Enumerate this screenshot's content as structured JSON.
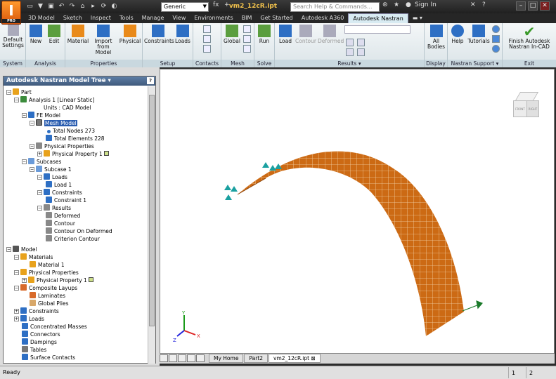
{
  "title": {
    "app_logo_letter": "I",
    "app_logo_badge": "PRO",
    "document": "vm2_12cR.ipt",
    "material_dropdown": "Generic",
    "search_placeholder": "Search Help & Commands...",
    "sign_in": "Sign In"
  },
  "tabs": [
    "3D Model",
    "Sketch",
    "Inspect",
    "Tools",
    "Manage",
    "View",
    "Environments",
    "BIM",
    "Get Started",
    "Autodesk A360",
    "Autodesk Nastran"
  ],
  "active_tab": "Autodesk Nastran",
  "ribbon": {
    "system": {
      "label": "System",
      "buttons": [
        "Default Settings"
      ]
    },
    "analysis": {
      "label": "Analysis",
      "buttons": [
        "New",
        "Edit"
      ]
    },
    "properties": {
      "label": "Properties",
      "buttons": [
        "Material",
        "Import from Model",
        "Physical"
      ]
    },
    "setup": {
      "label": "Setup",
      "buttons": [
        "Constraints",
        "Loads"
      ]
    },
    "contacts": {
      "label": "Contacts"
    },
    "mesh": {
      "label": "Mesh",
      "buttons": [
        "Global"
      ]
    },
    "solve": {
      "label": "Solve",
      "buttons": [
        "Run"
      ]
    },
    "results": {
      "label": "Results",
      "buttons": [
        "Load",
        "Contour",
        "Deformed"
      ]
    },
    "display": {
      "label": "Display",
      "buttons": [
        "All Bodies"
      ]
    },
    "support": {
      "label": "Nastran Support",
      "buttons": [
        "Help",
        "Tutorials"
      ]
    },
    "exit": {
      "label": "Exit",
      "buttons": [
        "Finish Autodesk Nastran In-CAD"
      ]
    }
  },
  "tree": {
    "header": "Autodesk Nastran Model Tree",
    "help_glyph": "?",
    "items": [
      "Part",
      "Analysis 1 [Linear Static]",
      "Units : CAD Model",
      "FE Model",
      "Mesh Model",
      "Total Nodes 273",
      "Total Elements 228",
      "Physical Properties",
      "Physical Property 1",
      "Subcases",
      "Subcase 1",
      "Loads",
      "Load 1",
      "Constraints",
      "Constraint 1",
      "Results",
      "Deformed",
      "Contour",
      "Contour On Deformed",
      "Criterion Contour",
      "Model",
      "Materials",
      "Material 1",
      "Physical Properties",
      "Physical Property 1",
      "Composite Layups",
      "Laminates",
      "Global Plies",
      "Constraints",
      "Loads",
      "Concentrated Masses",
      "Connectors",
      "Dampings",
      "Tables",
      "Surface Contacts"
    ]
  },
  "viewcube_labels": [
    "FRONT",
    "RIGHT"
  ],
  "axes": {
    "x": "X",
    "y": "Y",
    "z": "Z"
  },
  "doc_tabs": [
    "My Home",
    "Part2",
    "vm2_12cR.ipt"
  ],
  "active_doc_tab": "vm2_12cR.ipt",
  "status": {
    "text": "Ready",
    "count1": "1",
    "count2": "2"
  },
  "colors": {
    "mesh": "#cc6a14",
    "accent_tab": "#d8ebf2",
    "tree_header": "#4f6c92"
  }
}
